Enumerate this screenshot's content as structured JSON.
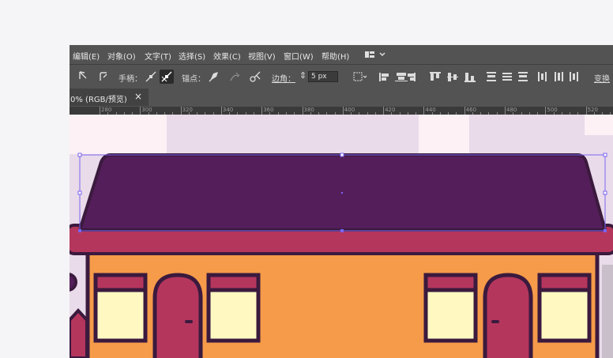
{
  "menu": [
    "编辑(E)",
    "对象(O)",
    "文字(T)",
    "选择(S)",
    "效果(C)",
    "视图(V)",
    "窗口(W)",
    "帮助(H)"
  ],
  "control_bar": {
    "handle_label": "手柄：",
    "anchor_label": "锚点：",
    "corner_label": "边角：",
    "corner_value": "5 px",
    "transform_label": "变换"
  },
  "tab": {
    "title": "0% (RGB/预览)",
    "close": "×"
  },
  "ruler_labels": [
    "280",
    "300",
    "320",
    "340",
    "360",
    "380",
    "400",
    "420",
    "440",
    "460",
    "480",
    "500",
    "520"
  ],
  "colors": {
    "roof": "#541e5a",
    "roof_outline": "#3b1a3e",
    "eave": "#b5365d",
    "wall": "#f59b49",
    "window_pane": "#fff9c1",
    "window_head": "#b5365d",
    "door": "#b5365d",
    "selection": "#7b64f0",
    "canvas_bg": "#e9dbea"
  },
  "icons": [
    "direct-select-icon",
    "convert-anchor-icon",
    "smooth-handle-icon",
    "corner-handle-icon",
    "pen-icon",
    "anchor-delete-icon",
    "cut-path-icon",
    "workspace-switcher-icon",
    "align-icon"
  ]
}
